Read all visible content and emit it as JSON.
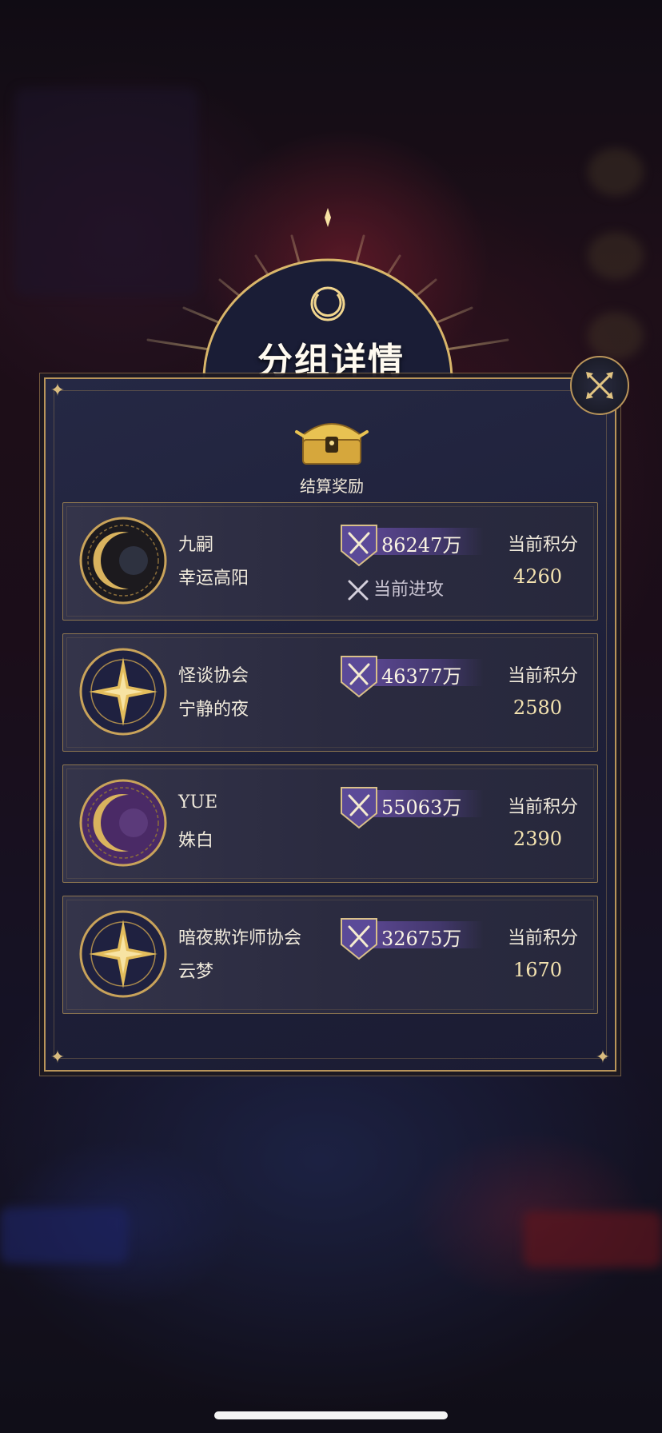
{
  "dialog": {
    "title": "分组详情"
  },
  "reward": {
    "label": "结算奖励"
  },
  "score_label": "当前积分",
  "attack_label": "当前进攻",
  "groups": [
    {
      "guild": "九嗣",
      "player": "幸运高阳",
      "power": "86247万",
      "score": "4260",
      "attacking": true,
      "emblem": "crescent-moon-emblem"
    },
    {
      "guild": "怪谈协会",
      "player": "宁静的夜",
      "power": "46377万",
      "score": "2580",
      "attacking": false,
      "emblem": "compass-star-emblem"
    },
    {
      "guild": "YUE",
      "player": "姝白",
      "power": "55063万",
      "score": "2390",
      "attacking": false,
      "emblem": "crescent-moon-emblem-purple"
    },
    {
      "guild": "暗夜欺诈师协会",
      "player": "云梦",
      "power": "32675万",
      "score": "1670",
      "attacking": false,
      "emblem": "compass-star-emblem"
    }
  ],
  "colors": {
    "gold": "#b9955a",
    "panel": "#1e2039",
    "power_bar": "#5a4690"
  }
}
